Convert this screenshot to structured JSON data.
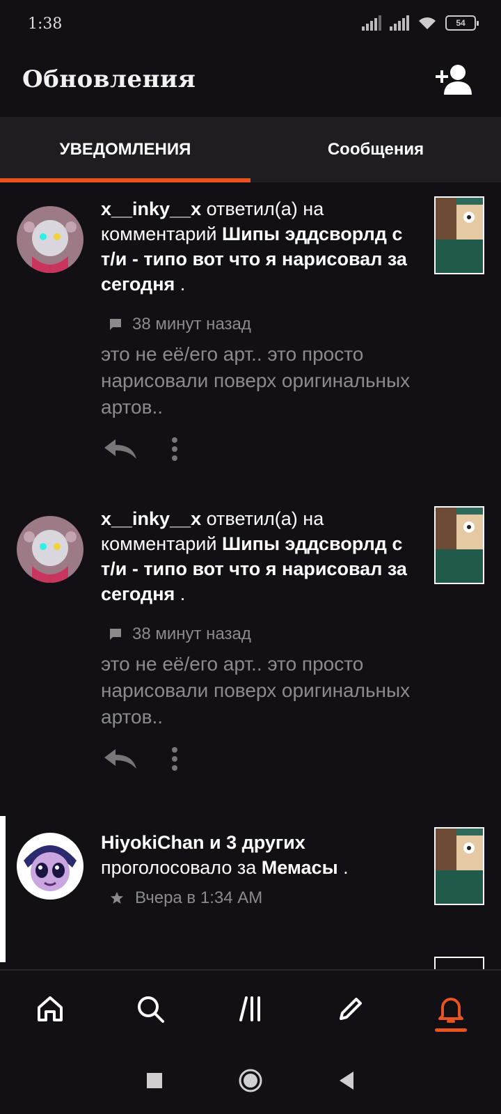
{
  "status_bar": {
    "time": "1:38",
    "battery": "54"
  },
  "header": {
    "title": "Обновления",
    "add_user_icon": "add-user-icon"
  },
  "tabs": [
    {
      "label": "УВЕДОМЛЕНИЯ",
      "active": true
    },
    {
      "label": "Сообщения",
      "active": false
    }
  ],
  "notifications": [
    {
      "user": "x__inky__x",
      "action": " ответил(а) на комментарий ",
      "target": "Шипы эддсворлд с т/и - типо вот что я нарисовал за сегодня",
      "end": " .",
      "meta_icon": "comment-icon",
      "time": "38 минут назад",
      "comment": "это не её/его арт.. это просто нарисовали поверх оригинальных артов.."
    },
    {
      "user": "x__inky__x",
      "action": " ответил(а) на комментарий ",
      "target": "Шипы эддсворлд с т/и - типо вот что я нарисовал за сегодня",
      "end": " .",
      "meta_icon": "comment-icon",
      "time": "38 минут назад",
      "comment": "это не её/его арт.. это просто нарисовали поверх оригинальных артов.."
    },
    {
      "user": "HiyokiChan и 3 других",
      "action": " проголосовало за ",
      "target": "Мемасы",
      "end": " .",
      "meta_icon": "star-icon",
      "time": "Вчера в 1:34 AM"
    }
  ],
  "bottom_nav": [
    {
      "icon": "home-icon"
    },
    {
      "icon": "search-icon"
    },
    {
      "icon": "library-icon"
    },
    {
      "icon": "write-icon"
    },
    {
      "icon": "bell-icon",
      "active": true
    }
  ],
  "colors": {
    "accent": "#e8531f",
    "background": "#121014",
    "tab_bg": "#1f1d21",
    "muted": "#8b8b8b"
  }
}
